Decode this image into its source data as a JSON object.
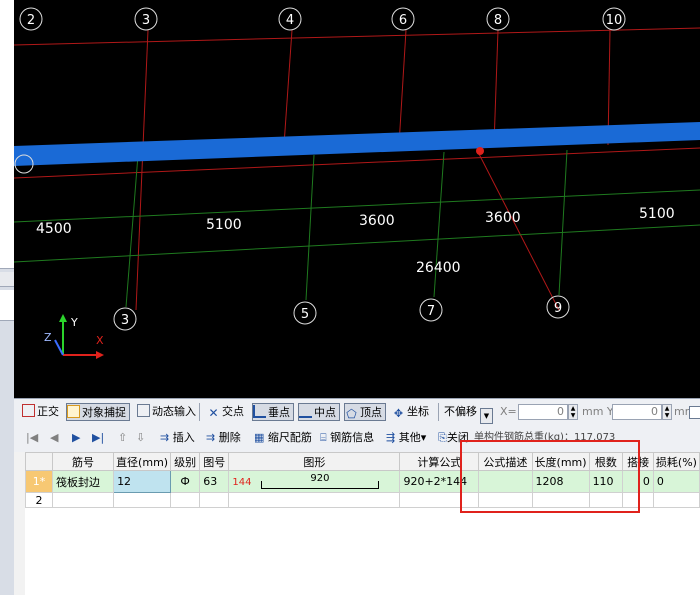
{
  "viewport": {
    "axis_top": [
      "2",
      "3",
      "4",
      "6",
      "8",
      "10"
    ],
    "axis_bottom": [
      "3",
      "5",
      "7",
      "9"
    ],
    "dims_row1": [
      "4500",
      "5100",
      "3600",
      "3600",
      "5100"
    ],
    "dim_total": "26400",
    "ucs": {
      "x": "X",
      "y": "Y",
      "z": "Z"
    }
  },
  "snapbar": {
    "ortho": "正交",
    "snap": "对象捕捉",
    "dynamic": "动态输入",
    "intersection": "交点",
    "perpendicular": "垂点",
    "midpoint": "中点",
    "vertex": "顶点",
    "coordinate": "坐标",
    "offset": "不偏移",
    "x_label": "X=",
    "x_value": "0",
    "y_label": "mm Y=",
    "y_value": "0",
    "mm2": "mm"
  },
  "rebarbar": {
    "insert": "插入",
    "delete": "删除",
    "scale": "缩尺配筋",
    "info": "钢筋信息",
    "other": "其他",
    "close": "关闭",
    "total": "单构件钢筋总重(kg)：117.073"
  },
  "table": {
    "headers": [
      "筋号",
      "直径(mm)",
      "级别",
      "图号",
      "图形",
      "计算公式",
      "公式描述",
      "长度(mm)",
      "根数",
      "搭接",
      "损耗(%)"
    ],
    "row1": {
      "index": "1*",
      "name": "筏板封边",
      "diameter": "12",
      "grade": "Ф",
      "fig_no": "63",
      "shape_left": "144",
      "shape_mid": "920",
      "formula": "920+2*144",
      "desc": "",
      "length": "1208",
      "count": "110",
      "lap": "0",
      "loss": "0"
    },
    "row2_index": "2"
  }
}
